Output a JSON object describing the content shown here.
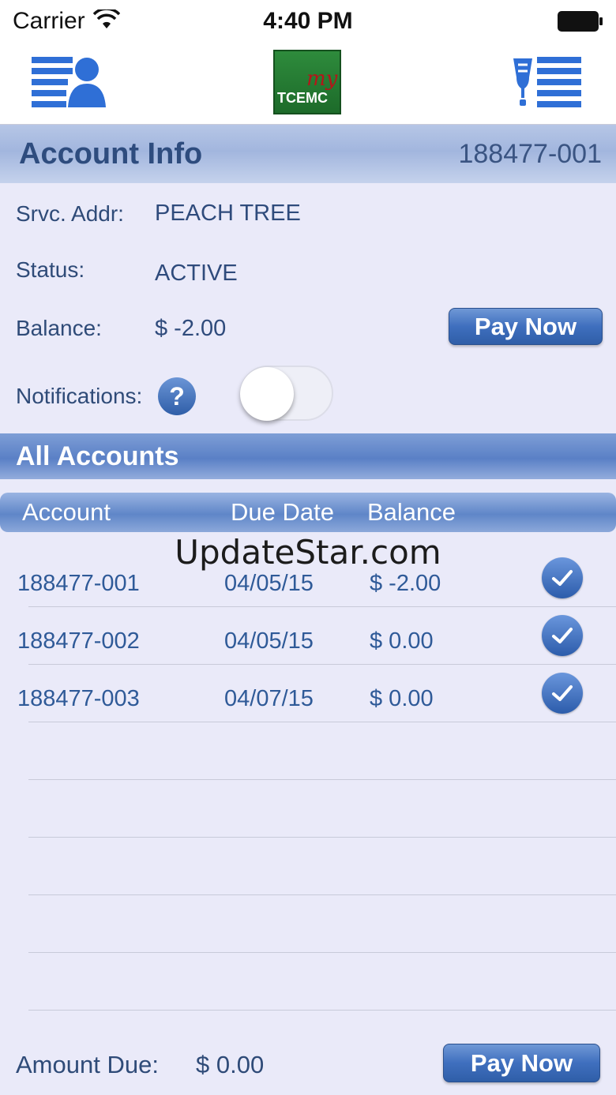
{
  "status_bar": {
    "carrier": "Carrier",
    "time": "4:40 PM"
  },
  "nav": {
    "left_icon": "account-list-icon",
    "right_icon": "outage-list-icon",
    "logo_small": "my",
    "logo_text": "TCEMC"
  },
  "account_info": {
    "title": "Account Info",
    "account_number": "188477-001",
    "service_address_label": "Srvc. Addr:",
    "service_address": "PEACH TREE",
    "status_label": "Status:",
    "status": "ACTIVE",
    "balance_label": "Balance:",
    "balance": "$ -2.00",
    "pay_now_label": "Pay Now",
    "notifications_label": "Notifications:",
    "help_label": "?",
    "notifications_enabled": false
  },
  "all_accounts": {
    "title": "All Accounts",
    "columns": [
      "Account",
      "Due Date",
      "Balance"
    ],
    "rows": [
      {
        "account": "188477-001",
        "due_date": "04/05/15",
        "balance": "$ -2.00",
        "selected": true
      },
      {
        "account": "188477-002",
        "due_date": "04/05/15",
        "balance": "$ 0.00",
        "selected": true
      },
      {
        "account": "188477-003",
        "due_date": "04/07/15",
        "balance": "$ 0.00",
        "selected": true
      }
    ]
  },
  "watermark": "UpdateStar.com",
  "footer": {
    "amount_due_label": "Amount Due:",
    "amount_due": "$ 0.00",
    "pay_now_label": "Pay Now"
  },
  "colors": {
    "background": "#eaeaf9",
    "accent": "#3f6fbe",
    "text": "#2f4b78",
    "logo_green": "#2e8b3c"
  }
}
